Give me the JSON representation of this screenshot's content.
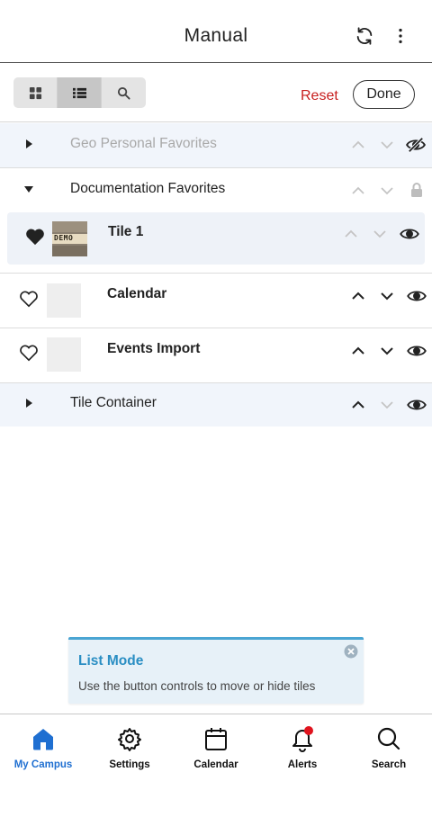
{
  "header": {
    "title": "Manual",
    "refresh_icon": "refresh-icon",
    "more_icon": "more-vertical-icon"
  },
  "toolbar": {
    "view_modes": [
      {
        "icon": "grid-icon",
        "active": false
      },
      {
        "icon": "list-icon",
        "active": true
      },
      {
        "icon": "search-icon",
        "active": false
      }
    ],
    "reset_label": "Reset",
    "done_label": "Done"
  },
  "rows": [
    {
      "label": "Geo Personal Favorites",
      "muted": true,
      "expanded": false,
      "up_enabled": false,
      "down_enabled": false,
      "visibility": "hidden"
    },
    {
      "label": "Documentation Favorites",
      "muted": false,
      "expanded": true,
      "up_enabled": false,
      "down_enabled": false,
      "visibility": "locked"
    },
    {
      "label": "Tile 1",
      "favorited": true,
      "thumbnail_text": "DEMO",
      "up_enabled": false,
      "down_enabled": false,
      "visibility": "visible"
    },
    {
      "label": "Calendar",
      "favorited": false,
      "up_enabled": true,
      "down_enabled": true,
      "visibility": "visible"
    },
    {
      "label": "Events Import",
      "favorited": false,
      "up_enabled": true,
      "down_enabled": true,
      "visibility": "visible"
    },
    {
      "label": "Tile Container",
      "expanded": false,
      "up_enabled": true,
      "down_enabled": false,
      "visibility": "visible"
    }
  ],
  "toast": {
    "title": "List Mode",
    "text": "Use the button controls to move or hide tiles"
  },
  "bottom_nav": [
    {
      "label": "My Campus",
      "icon": "home-icon",
      "active": true
    },
    {
      "label": "Settings",
      "icon": "gear-icon",
      "active": false
    },
    {
      "label": "Calendar",
      "icon": "calendar-icon",
      "active": false
    },
    {
      "label": "Alerts",
      "icon": "bell-icon",
      "active": false,
      "badge": true
    },
    {
      "label": "Search",
      "icon": "search-icon",
      "active": false
    }
  ],
  "colors": {
    "accent": "#1f6fd1",
    "reset": "#c8201f",
    "toast_accent": "#2a8ec3",
    "badge": "#e0141e",
    "row_tint": "#f1f5fb"
  }
}
